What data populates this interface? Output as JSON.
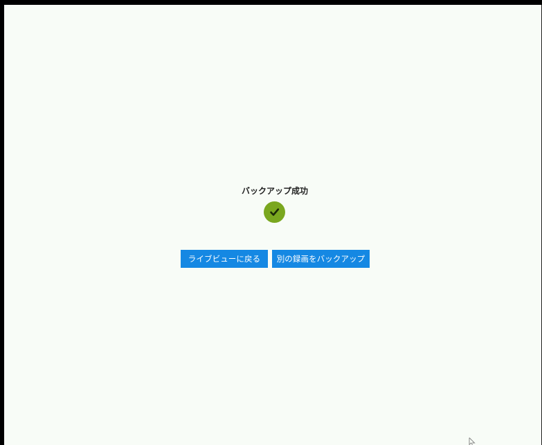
{
  "dialog": {
    "title": "バックアップ成功",
    "status_icon": "checkmark-circle-icon",
    "status_color": "#7aa71f"
  },
  "actions": {
    "back_to_live_label": "ライブビューに戻る",
    "backup_another_label": "別の録画をバックアップ",
    "button_color": "#1588e3"
  },
  "pointer": {
    "icon": "mouse-pointer-icon"
  }
}
